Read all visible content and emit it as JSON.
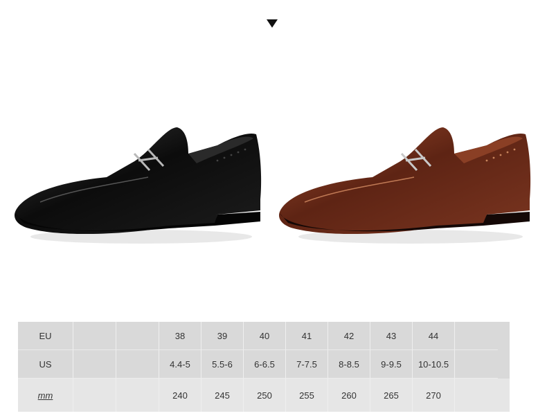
{
  "size_chart": {
    "rows": [
      {
        "label": "EU",
        "values": [
          "38",
          "39",
          "40",
          "41",
          "42",
          "43",
          "44"
        ]
      },
      {
        "label": "US",
        "values": [
          "4.4-5",
          "5.5-6",
          "6-6.5",
          "7-7.5",
          "8-8.5",
          "9-9.5",
          "10-10.5"
        ]
      },
      {
        "label": "mm",
        "values": [
          "240",
          "245",
          "250",
          "255",
          "260",
          "265",
          "270"
        ]
      }
    ]
  },
  "colors": {
    "black_shoe": "#111111",
    "brown_shoe": "#6b2a17",
    "table_bg": "#d9d9d9",
    "marker": "#111111"
  },
  "icons": [
    "down-triangle-icon"
  ]
}
